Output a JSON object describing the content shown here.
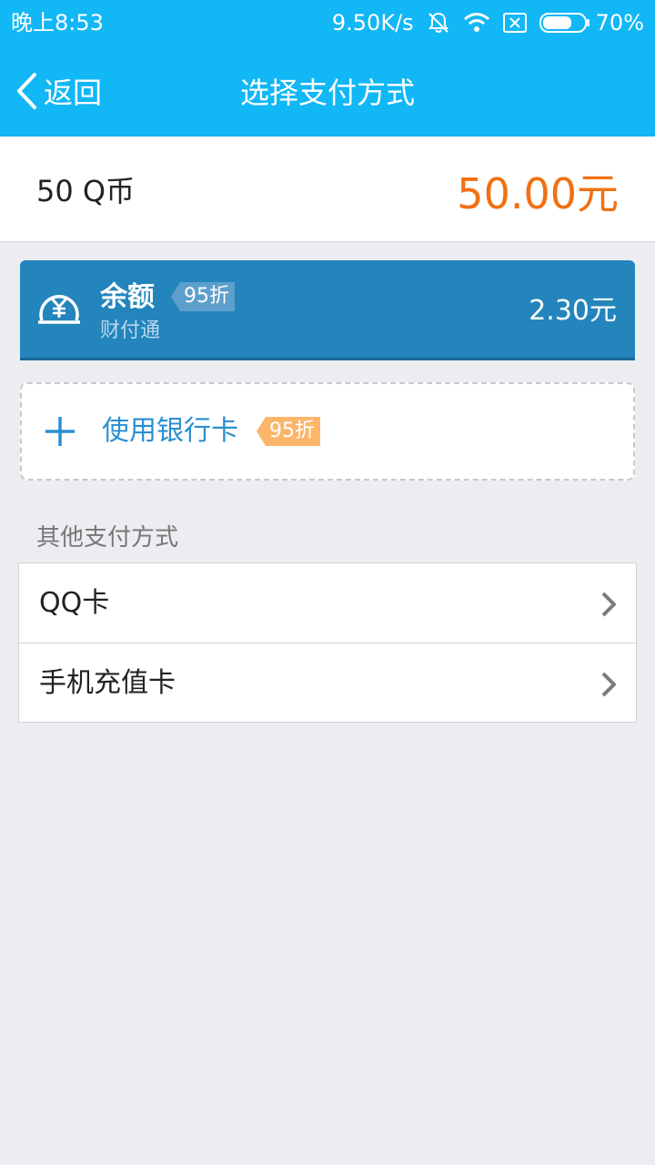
{
  "status_bar": {
    "time": "晚上8:53",
    "network_speed": "9.50K/s",
    "battery_percent": "70%",
    "battery_level": 0.7
  },
  "nav": {
    "back_label": "返回",
    "title": "选择支付方式"
  },
  "product": {
    "name": "50 Q币",
    "price": "50.00元"
  },
  "balance": {
    "title": "余额",
    "discount": "95折",
    "provider": "财付通",
    "amount": "2.30元"
  },
  "bank_card": {
    "label": "使用银行卡",
    "discount": "95折"
  },
  "other_methods": {
    "title": "其他支付方式",
    "items": [
      {
        "label": "QQ卡"
      },
      {
        "label": "手机充值卡"
      }
    ]
  },
  "colors": {
    "header_bg": "#12b7f5",
    "price": "#f27012",
    "balance_card_bg": "#2385bc",
    "bank_link": "#2a8fd0",
    "bank_discount_bg": "#fbb66b"
  },
  "icons": {
    "back": "chevron-left-icon",
    "mute": "bell-off-icon",
    "wifi": "wifi-icon",
    "sim": "sim-off-icon",
    "battery": "battery-icon",
    "balance": "yuan-coin-icon",
    "add": "plus-icon",
    "forward": "chevron-right-icon"
  }
}
